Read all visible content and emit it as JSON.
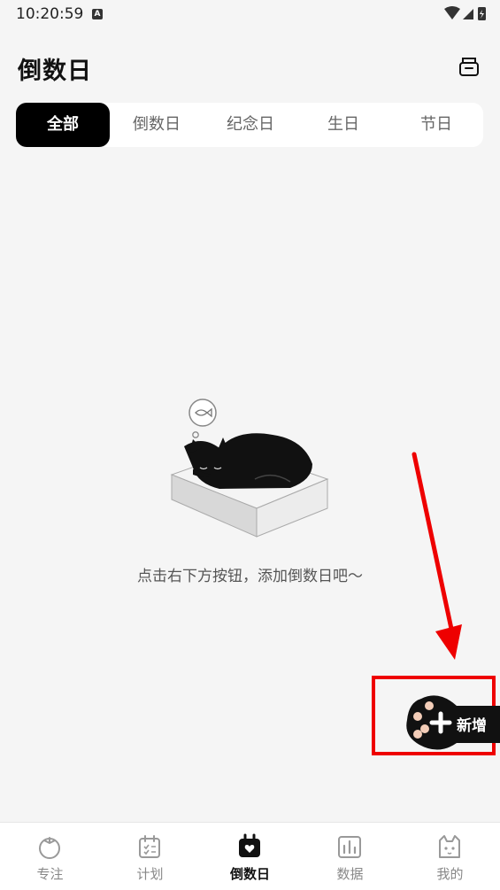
{
  "status": {
    "time": "10:20:59",
    "badge": "A"
  },
  "header": {
    "title": "倒数日"
  },
  "tabs": [
    {
      "label": "全部",
      "active": true
    },
    {
      "label": "倒数日",
      "active": false
    },
    {
      "label": "纪念日",
      "active": false
    },
    {
      "label": "生日",
      "active": false
    },
    {
      "label": "节日",
      "active": false
    }
  ],
  "empty": {
    "message": "点击右下方按钮，添加倒数日吧～"
  },
  "add_button": {
    "label": "新增"
  },
  "nav": [
    {
      "label": "专注",
      "icon": "tomato-icon"
    },
    {
      "label": "计划",
      "icon": "calendar-check-icon"
    },
    {
      "label": "倒数日",
      "icon": "calendar-heart-icon",
      "active": true
    },
    {
      "label": "数据",
      "icon": "bar-chart-icon"
    },
    {
      "label": "我的",
      "icon": "cat-face-icon"
    }
  ],
  "colors": {
    "accent": "#000000",
    "highlight": "#ee0000",
    "background": "#f5f5f5"
  }
}
